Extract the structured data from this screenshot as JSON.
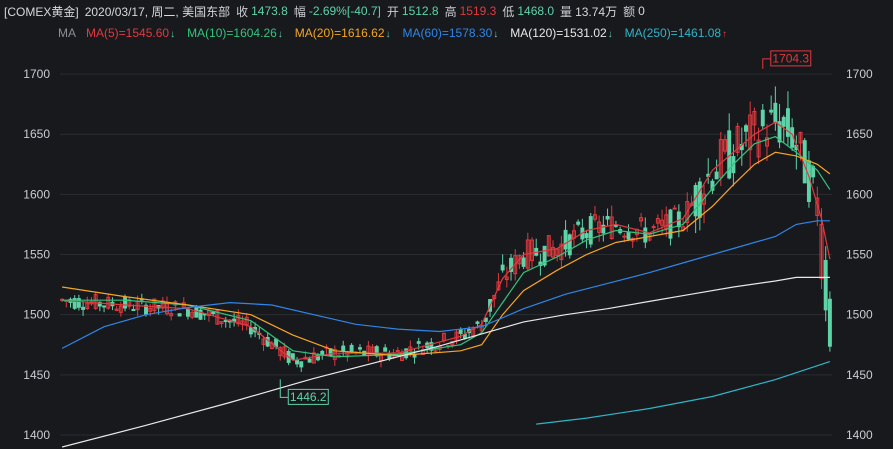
{
  "header": {
    "symbol": "[COMEX黄金]",
    "datetime": "2020/03/17, 周二, 美国东部",
    "close_label": "收",
    "close_value": "1473.8",
    "change_label": "幅",
    "change_pct": "-2.69%",
    "change_abs": "[-40.7]",
    "open_label": "开",
    "open_value": "1512.8",
    "high_label": "高",
    "high_value": "1519.3",
    "low_label": "低",
    "low_value": "1468.0",
    "volume_label": "量",
    "volume_value": "13.74万",
    "amount_label": "额",
    "amount_value": "0"
  },
  "ma_legend": {
    "tag": "MA",
    "items": [
      {
        "label": "MA(5)=1545.60",
        "dir": "down",
        "color": "#e0393e"
      },
      {
        "label": "MA(10)=1604.26",
        "dir": "down",
        "color": "#31c47b"
      },
      {
        "label": "MA(20)=1616.62",
        "dir": "down",
        "color": "#f5a623"
      },
      {
        "label": "MA(60)=1578.30",
        "dir": "down",
        "color": "#2f86e8"
      },
      {
        "label": "MA(120)=1531.02",
        "dir": "down",
        "color": "#e8e8e8"
      },
      {
        "label": "MA(250)=1461.08",
        "dir": "up",
        "color": "#2fb5c8"
      }
    ]
  },
  "colors": {
    "up": "#e0393e",
    "down": "#5fd3a8",
    "axis_text": "#c9ccd2",
    "grid": "#2a2c31",
    "bg": "#18191d"
  },
  "chart_data": {
    "type": "candlestick",
    "ylim": [
      1390,
      1725
    ],
    "y_ticks": [
      1400,
      1450,
      1500,
      1550,
      1600,
      1650,
      1700
    ],
    "annotations": [
      {
        "label": "1704.3",
        "value": 1704.3,
        "index": 167
      },
      {
        "label": "1446.2",
        "value": 1446.2,
        "index": 52
      }
    ],
    "ma_series": [
      {
        "name": "MA(5)",
        "color": "#e0393e",
        "points": [
          [
            0,
            1512
          ],
          [
            15,
            1508
          ],
          [
            30,
            1505
          ],
          [
            45,
            1490
          ],
          [
            55,
            1462
          ],
          [
            65,
            1468
          ],
          [
            80,
            1468
          ],
          [
            95,
            1482
          ],
          [
            100,
            1492
          ],
          [
            105,
            1530
          ],
          [
            110,
            1550
          ],
          [
            118,
            1555
          ],
          [
            125,
            1570
          ],
          [
            132,
            1575
          ],
          [
            140,
            1568
          ],
          [
            148,
            1580
          ],
          [
            155,
            1620
          ],
          [
            160,
            1635
          ],
          [
            165,
            1650
          ],
          [
            170,
            1660
          ],
          [
            174,
            1650
          ],
          [
            178,
            1615
          ],
          [
            181,
            1580
          ],
          [
            183,
            1546
          ]
        ]
      },
      {
        "name": "MA(10)",
        "color": "#31c47b",
        "points": [
          [
            0,
            1512
          ],
          [
            15,
            1512
          ],
          [
            30,
            1508
          ],
          [
            45,
            1495
          ],
          [
            55,
            1470
          ],
          [
            65,
            1465
          ],
          [
            80,
            1467
          ],
          [
            95,
            1475
          ],
          [
            100,
            1485
          ],
          [
            105,
            1510
          ],
          [
            110,
            1535
          ],
          [
            118,
            1548
          ],
          [
            125,
            1562
          ],
          [
            132,
            1570
          ],
          [
            140,
            1567
          ],
          [
            148,
            1575
          ],
          [
            155,
            1605
          ],
          [
            160,
            1625
          ],
          [
            165,
            1642
          ],
          [
            170,
            1648
          ],
          [
            175,
            1635
          ],
          [
            180,
            1620
          ],
          [
            183,
            1604
          ]
        ]
      },
      {
        "name": "MA(20)",
        "color": "#f5a623",
        "points": [
          [
            0,
            1523
          ],
          [
            15,
            1515
          ],
          [
            30,
            1508
          ],
          [
            45,
            1500
          ],
          [
            55,
            1483
          ],
          [
            65,
            1470
          ],
          [
            80,
            1466
          ],
          [
            95,
            1470
          ],
          [
            100,
            1475
          ],
          [
            105,
            1500
          ],
          [
            110,
            1520
          ],
          [
            118,
            1537
          ],
          [
            125,
            1550
          ],
          [
            132,
            1560
          ],
          [
            140,
            1565
          ],
          [
            148,
            1570
          ],
          [
            155,
            1590
          ],
          [
            160,
            1608
          ],
          [
            165,
            1625
          ],
          [
            170,
            1635
          ],
          [
            175,
            1632
          ],
          [
            180,
            1625
          ],
          [
            183,
            1617
          ]
        ]
      },
      {
        "name": "MA(60)",
        "color": "#2f86e8",
        "points": [
          [
            0,
            1472
          ],
          [
            10,
            1490
          ],
          [
            20,
            1500
          ],
          [
            30,
            1506
          ],
          [
            40,
            1510
          ],
          [
            50,
            1508
          ],
          [
            60,
            1500
          ],
          [
            70,
            1492
          ],
          [
            80,
            1488
          ],
          [
            90,
            1486
          ],
          [
            100,
            1490
          ],
          [
            110,
            1505
          ],
          [
            120,
            1517
          ],
          [
            130,
            1526
          ],
          [
            140,
            1535
          ],
          [
            150,
            1545
          ],
          [
            160,
            1555
          ],
          [
            170,
            1565
          ],
          [
            175,
            1575
          ],
          [
            180,
            1578
          ],
          [
            183,
            1578
          ]
        ]
      },
      {
        "name": "MA(120)",
        "color": "#e8e8e8",
        "points": [
          [
            0,
            1390
          ],
          [
            20,
            1408
          ],
          [
            40,
            1427
          ],
          [
            60,
            1447
          ],
          [
            80,
            1465
          ],
          [
            90,
            1474
          ],
          [
            100,
            1484
          ],
          [
            110,
            1494
          ],
          [
            120,
            1500
          ],
          [
            130,
            1505
          ],
          [
            140,
            1511
          ],
          [
            150,
            1517
          ],
          [
            160,
            1523
          ],
          [
            170,
            1528
          ],
          [
            175,
            1531
          ],
          [
            183,
            1531
          ]
        ]
      },
      {
        "name": "MA(250)",
        "color": "#2fb5c8",
        "points": [
          [
            113,
            1409
          ],
          [
            125,
            1414
          ],
          [
            140,
            1422
          ],
          [
            155,
            1432
          ],
          [
            170,
            1446
          ],
          [
            183,
            1461
          ]
        ]
      }
    ]
  }
}
